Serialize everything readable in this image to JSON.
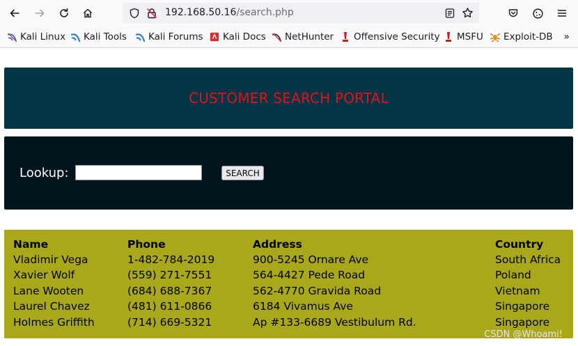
{
  "browser": {
    "url_host": "192.168.50.16",
    "url_path": "/search.php",
    "bookmarks": [
      {
        "label": "Kali Linux",
        "icon": "kali-dragon-icon"
      },
      {
        "label": "Kali Tools",
        "icon": "kali-tools-icon"
      },
      {
        "label": "Kali Forums",
        "icon": "kali-forums-icon"
      },
      {
        "label": "Kali Docs",
        "icon": "kali-docs-icon"
      },
      {
        "label": "NetHunter",
        "icon": "nethunter-icon"
      },
      {
        "label": "Offensive Security",
        "icon": "offensive-security-icon"
      },
      {
        "label": "MSFU",
        "icon": "msfu-icon"
      },
      {
        "label": "Exploit-DB",
        "icon": "exploit-db-icon"
      }
    ],
    "overflow_label": "»"
  },
  "page": {
    "title": "CUSTOMER SEARCH PORTAL",
    "title_color": "#e0131a",
    "lookup_label": "Lookup:",
    "lookup_value": "",
    "search_button": "SEARCH"
  },
  "table": {
    "headers": [
      "Name",
      "Phone",
      "Address",
      "Country"
    ],
    "rows": [
      [
        "Vladimir Vega",
        "1-482-784-2019",
        "900-5245 Ornare Ave",
        "South Africa"
      ],
      [
        "Xavier Wolf",
        "(559) 271-7551",
        "564-4427 Pede Road",
        "Poland"
      ],
      [
        "Lane Wooten",
        "(684) 688-7367",
        "562-4770 Gravida Road",
        "Vietnam"
      ],
      [
        "Laurel Chavez",
        "(481) 611-0866",
        "6184 Vivamus Ave",
        "Singapore"
      ],
      [
        "Holmes Griffith",
        "(714) 669-5321",
        "Ap #133-6689 Vestibulum Rd.",
        "Singapore"
      ]
    ]
  },
  "watermark": "CSDN @Whoami!"
}
